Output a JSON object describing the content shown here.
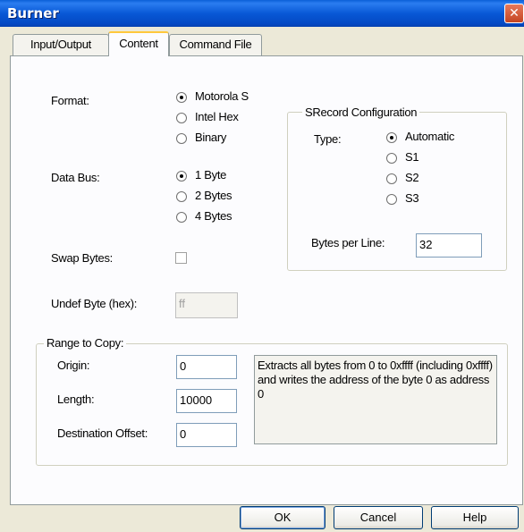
{
  "window": {
    "title": "Burner",
    "close_glyph": "✕"
  },
  "tabs": [
    {
      "label": "Input/Output",
      "active": false
    },
    {
      "label": "Content",
      "active": true
    },
    {
      "label": "Command File",
      "active": false
    }
  ],
  "format": {
    "label": "Format:",
    "options": [
      "Motorola S",
      "Intel Hex",
      "Binary"
    ],
    "selected": "Motorola S"
  },
  "data_bus": {
    "label": "Data Bus:",
    "options": [
      "1 Byte",
      "2 Bytes",
      "4 Bytes"
    ],
    "selected": "1 Byte"
  },
  "swap_bytes": {
    "label": "Swap Bytes:",
    "checked": false
  },
  "undef_byte": {
    "label": "Undef Byte (hex):",
    "value": "ff"
  },
  "srecord": {
    "legend": "SRecord Configuration",
    "type_label": "Type:",
    "type_options": [
      "Automatic",
      "S1",
      "S2",
      "S3"
    ],
    "selected": "Automatic",
    "bytes_per_line_label": "Bytes per Line:",
    "bytes_per_line_value": "32"
  },
  "range": {
    "legend": "Range to Copy:",
    "origin_label": "Origin:",
    "origin_value": "0",
    "length_label": "Length:",
    "length_value": "10000",
    "dest_label": "Destination Offset:",
    "dest_value": "0",
    "description": "Extracts all bytes from 0 to 0xffff (including 0xffff) and writes the address of the byte 0 as address 0"
  },
  "buttons": {
    "ok": "OK",
    "cancel": "Cancel",
    "help": "Help"
  },
  "colors": {
    "titlebar": "#0858d6",
    "dialog_bg": "#ece9d8",
    "tab_highlight": "#ffc83c",
    "close": "#c44522"
  }
}
